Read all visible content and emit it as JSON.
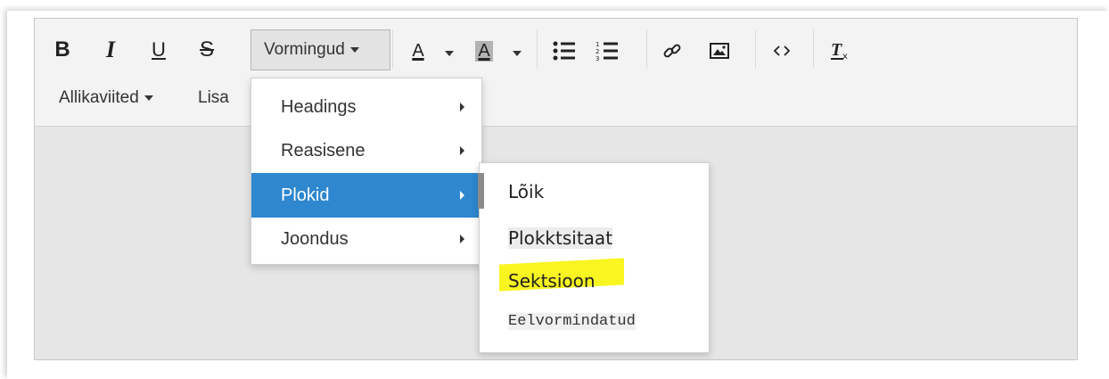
{
  "toolbar": {
    "bold_label": "B",
    "italic_label": "I",
    "underline_label": "U",
    "strike_label": "S",
    "formats_label": "Vormingud",
    "text_color_label": "A",
    "bg_color_label": "A",
    "references_label": "Allikaviited",
    "insert_label": "Lisa"
  },
  "icons": {
    "bullet_list": "bullet-list-icon",
    "numbered_list": "numbered-list-icon",
    "link": "link-icon",
    "image": "image-icon",
    "code": "code-icon",
    "clear_format": "clear-format-icon"
  },
  "formats_menu": {
    "items": [
      {
        "label": "Headings",
        "active": false
      },
      {
        "label": "Reasisene",
        "active": false
      },
      {
        "label": "Plokid",
        "active": true
      },
      {
        "label": "Joondus",
        "active": false
      }
    ]
  },
  "blocks_submenu": {
    "items": [
      {
        "label": "Lõik"
      },
      {
        "label": "Plokktsitaat"
      },
      {
        "label": "Sektsioon",
        "highlighted": true
      },
      {
        "label": "Eelvormindatud"
      }
    ]
  },
  "colors": {
    "menu_active_bg": "#2e87cf",
    "highlight": "#f8f521"
  }
}
